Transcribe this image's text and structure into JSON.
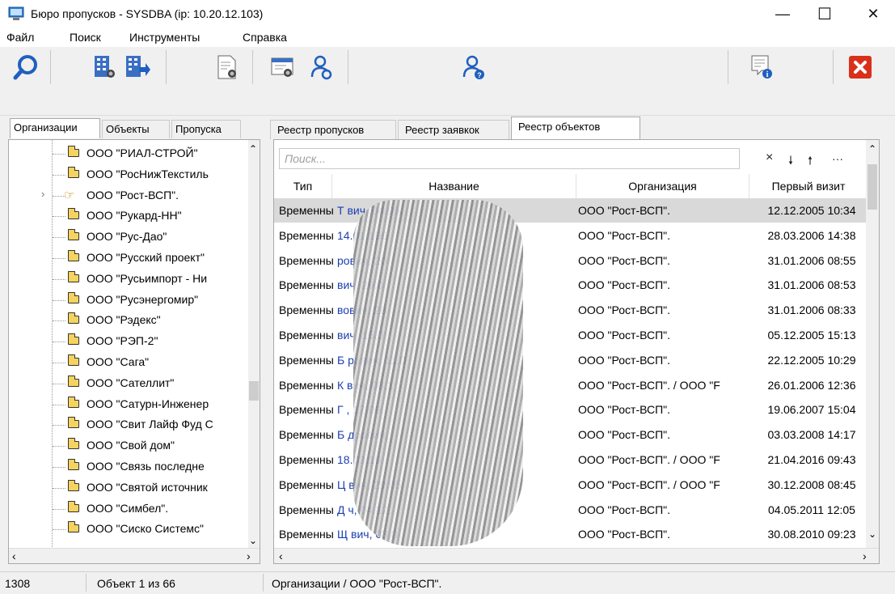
{
  "window": {
    "title": "Бюро пропусков - SYSDBA  (ip: 10.20.12.103)",
    "minimize": "—",
    "maximize": "☐",
    "close": "✕"
  },
  "menu": [
    {
      "label": "Файл"
    },
    {
      "label": "Поиск"
    },
    {
      "label": "Инструменты"
    },
    {
      "label": "Справка"
    }
  ],
  "toolbar": {
    "icons": [
      "search-icon",
      "org-search-icon",
      "org-export-icon",
      "doc-search-icon",
      "pass-search-icon",
      "visitor-search-icon",
      "visitor-check-icon",
      "info-icon",
      "close-app-icon"
    ]
  },
  "left_tabs": [
    "Организации",
    "Объекты",
    "Пропуска"
  ],
  "tree": {
    "items": [
      "ООО \"РИАЛ-СТРОЙ\"",
      "ООО \"РосНижТекстиль",
      "ООО \"Рост-ВСП\".",
      "ООО \"Рукард-НН\"",
      "ООО \"Рус-Дао\"",
      "ООО \"Русский проект\"",
      "ООО \"Русьимпорт - Ни",
      "ООО \"Русэнергомир\"",
      "ООО \"Рэдекс\"",
      "ООО \"РЭП-2\"",
      "ООО \"Сага\"",
      "ООО \"Сателлит\"",
      "ООО \"Сатурн-Инженер",
      "ООО \"Свит Лайф Фуд С",
      "ООО \"Свой дом\"",
      "ООО \"Связь последне",
      "ООО \"Святой источник",
      "ООО \"Симбел\".",
      "ООО \"Сиско Системс\""
    ],
    "selected_index": 2
  },
  "right_tabs": [
    "Реестр пропусков",
    "Реестр заявкок",
    "Реестр объектов"
  ],
  "grid": {
    "search_placeholder": "Поиск...",
    "search_buttons": [
      "×",
      "🠗",
      "🠕",
      "···"
    ],
    "headers": [
      "Тип",
      "Название",
      "Организация",
      "Первый визит"
    ],
    "rows": [
      {
        "type": "Временны",
        "name": "Т                                              вич, 04.05.",
        "org": "ООО \"Рост-ВСП\".",
        "visit": "12.12.2005 10:34"
      },
      {
        "type": "Временны",
        "name": "                                                14.01.196",
        "org": "ООО \"Рост-ВСП\".",
        "visit": "28.03.2006 14:38"
      },
      {
        "type": "Временны",
        "name": "                                              рович, 20",
        "org": "ООО \"Рост-ВСП\".",
        "visit": "31.01.2006 08:55"
      },
      {
        "type": "Временны",
        "name": "                                              вич, 29.0",
        "org": "ООО \"Рост-ВСП\".",
        "visit": "31.01.2006 08:53"
      },
      {
        "type": "Временны",
        "name": "                                              вович, 28",
        "org": "ООО \"Рост-ВСП\".",
        "visit": "31.01.2006 08:33"
      },
      {
        "type": "Временны",
        "name": "                                              вич, 15.0",
        "org": "ООО \"Рост-ВСП\".",
        "visit": "05.12.2005 15:13"
      },
      {
        "type": "Временны",
        "name": "Б                                             рович, 11.0",
        "org": "ООО \"Рост-ВСП\".",
        "visit": "22.12.2005 10:29"
      },
      {
        "type": "Временны",
        "name": "К                                              вич, 08.1",
        "org": "ООО \"Рост-ВСП\". / ООО \"F",
        "visit": "26.01.2006 12:36"
      },
      {
        "type": "Временны",
        "name": "Г                                           , 17.09.",
        "org": "ООО \"Рост-ВСП\".",
        "visit": "19.06.2007 15:04"
      },
      {
        "type": "Временны",
        "name": "Б                                           дрович,",
        "org": "ООО \"Рост-ВСП\".",
        "visit": "03.03.2008 14:17"
      },
      {
        "type": "Временны",
        "name": "                                              18.03.19",
        "org": "ООО \"Рост-ВСП\". / ООО \"F",
        "visit": "21.04.2016 09:43"
      },
      {
        "type": "Временны",
        "name": "Ц                                             вич, 29.05",
        "org": "ООО \"Рост-ВСП\". / ООО \"F",
        "visit": "30.12.2008 08:45"
      },
      {
        "type": "Временны",
        "name": "Д                                          ч, 04.12.",
        "org": "ООО \"Рост-ВСП\".",
        "visit": "04.05.2011 12:05"
      },
      {
        "type": "Временны",
        "name": "Щ                                           вич, 03.0",
        "org": "ООО \"Рост-ВСП\".",
        "visit": "30.08.2010 09:23"
      }
    ]
  },
  "statusbar": {
    "count": "1308",
    "object": "Объект 1 из 66",
    "path": "Организации / ООО \"Рост-ВСП\"."
  }
}
